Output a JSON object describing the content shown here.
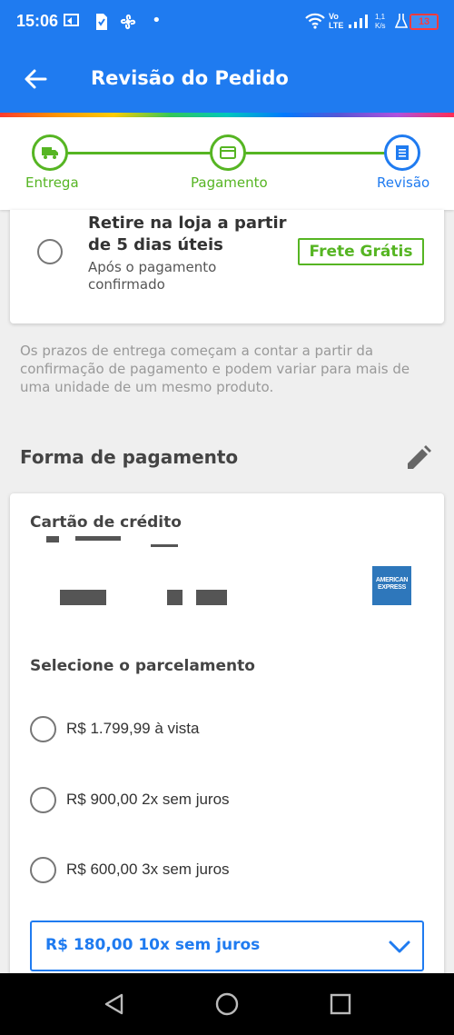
{
  "status_bar": {
    "time": "15:06",
    "dot": "•",
    "network": "Vo\nLTE",
    "speed": "1,1\nK/s",
    "battery": "13"
  },
  "app_bar": {
    "title": "Revisão do Pedido",
    "back_icon": "arrow-left-icon"
  },
  "stepper": {
    "steps": [
      {
        "label": "Entrega",
        "icon": "truck-icon",
        "state": "done"
      },
      {
        "label": "Pagamento",
        "icon": "card-icon",
        "state": "done"
      },
      {
        "label": "Revisão",
        "icon": "receipt-icon",
        "state": "active"
      }
    ]
  },
  "pickup": {
    "title": "Retire na loja a partir de 5 dias úteis",
    "subtitle": "Após o pagamento confirmado",
    "badge": "Frete Grátis"
  },
  "notice": "Os prazos de entrega começam a contar a partir da confirmação de pagamento e podem variar para mais de uma unidade de um mesmo produto.",
  "payment": {
    "section_title": "Forma de pagamento",
    "card_title": "Cartão de crédito",
    "brand_logo": "AMERICAN EXPRESS",
    "installments_title": "Selecione o parcelamento",
    "options": [
      "R$ 1.799,99 à vista",
      "R$ 900,00 2x sem juros",
      "R$ 600,00 3x sem juros"
    ],
    "selected": "R$ 180,00 10x sem juros"
  },
  "colors": {
    "primary": "#1f7bf0",
    "success": "#56b523"
  }
}
